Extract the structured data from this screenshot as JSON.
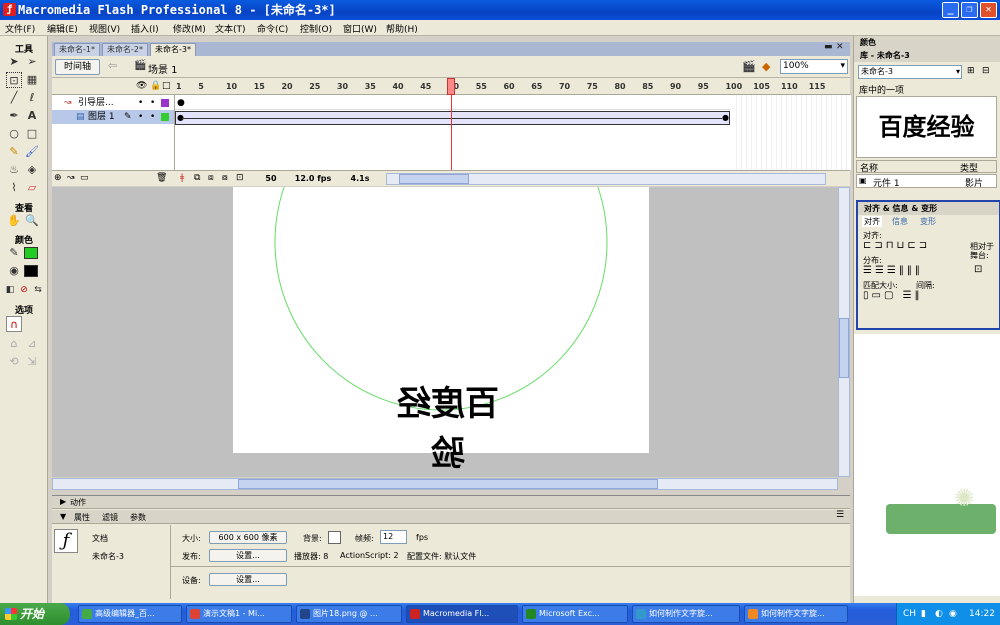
{
  "window": {
    "title": "Macromedia Flash Professional 8 - [未命名-3*]"
  },
  "menu": [
    "文件(F)",
    "编辑(E)",
    "视图(V)",
    "插入(I)",
    "修改(M)",
    "文本(T)",
    "命令(C)",
    "控制(O)",
    "窗口(W)",
    "帮助(H)"
  ],
  "tools": {
    "label_tools": "工具",
    "label_view": "查看",
    "label_colors": "颜色",
    "label_options": "选项"
  },
  "doc_tabs": [
    "未命名-1*",
    "未命名-2*",
    "未命名-3*"
  ],
  "nav": {
    "timeline_button": "时间轴",
    "scene": "场景 1",
    "zoom": "100%"
  },
  "timeline": {
    "frame_numbers": [
      "1",
      "5",
      "10",
      "15",
      "20",
      "25",
      "30",
      "35",
      "40",
      "45",
      "50",
      "55",
      "60",
      "65",
      "70",
      "75",
      "80",
      "85",
      "90",
      "95",
      "100",
      "105",
      "110",
      "115"
    ],
    "layers": [
      {
        "name": "引导层..."
      },
      {
        "name": "图层 1"
      }
    ],
    "current_frame": "50",
    "fps": "12.0 fps",
    "time": "4.1s"
  },
  "stage": {
    "text": "百度经验"
  },
  "panels": {
    "actions": "动作",
    "tab_properties": "属性",
    "tab_filters": "滤镜",
    "tab_params": "参数"
  },
  "properties": {
    "doc_label": "文档",
    "doc_name": "未命名-3",
    "size_label": "大小:",
    "size_value": "600 x 600 像素",
    "bg_label": "背景:",
    "fps_label": "帧频:",
    "fps_value": "12",
    "fps_unit": "fps",
    "publish_label": "发布:",
    "settings_button": "设置...",
    "player": "播放器: 8",
    "as": "ActionScript: 2",
    "profile": "配置文件: 默认文件",
    "device_label": "设备:",
    "device_button": "设置..."
  },
  "right": {
    "color_header": "颜色",
    "library_header": "库 - 未命名-3",
    "library_select": "未命名-3",
    "library_count": "库中的一项",
    "preview_text": "百度经验",
    "col_name": "名称",
    "col_type": "类型",
    "item_name": "元件 1",
    "item_type": "影片",
    "align_header": "对齐 & 信息 & 变形",
    "align_tabs": [
      "对齐",
      "信息",
      "变形"
    ],
    "align_label": "对齐:",
    "distribute_label": "分布:",
    "match_label": "匹配大小:",
    "spacing_label": "间隔:",
    "relative_label": "相对于舞台:"
  },
  "taskbar": {
    "start": "开始",
    "tasks": [
      "高级编辑器_百...",
      "演示文稿1 - Mi...",
      "图片18.png @ ...",
      "Macromedia Fl...",
      "Microsoft Exc...",
      "如何制作文字旋...",
      "如何制作文字旋..."
    ],
    "tray_lang": "CH",
    "clock": "14:22"
  }
}
